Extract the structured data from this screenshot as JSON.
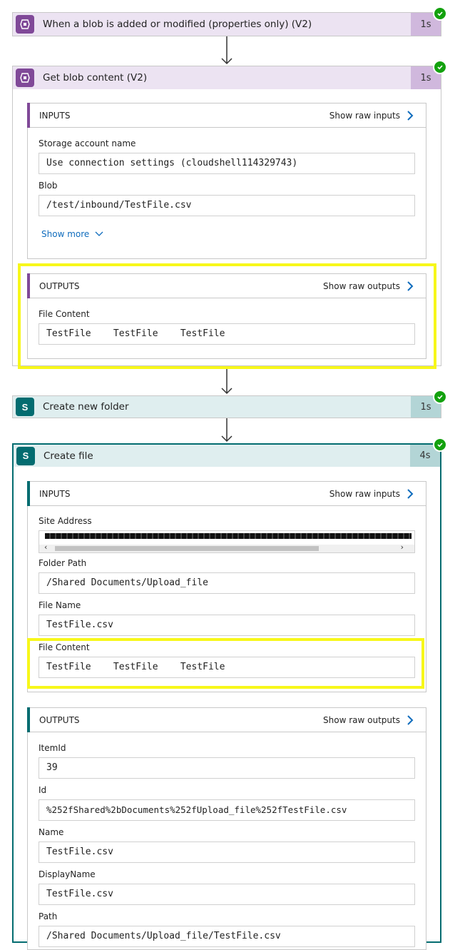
{
  "step1": {
    "title": "When a blob is added or modified (properties only) (V2)",
    "duration": "1s"
  },
  "step2": {
    "title": "Get blob content (V2)",
    "duration": "1s",
    "inputs": {
      "label": "INPUTS",
      "raw_label": "Show raw inputs",
      "storage_label": "Storage account name",
      "storage_value": "Use connection settings (cloudshell114329743)",
      "blob_label": "Blob",
      "blob_value": "/test/inbound/TestFile.csv",
      "show_more": "Show more"
    },
    "outputs": {
      "label": "OUTPUTS",
      "raw_label": "Show raw outputs",
      "file_content_label": "File Content",
      "file_content_value": "TestFile    TestFile    TestFile"
    }
  },
  "step3": {
    "title": "Create new folder",
    "duration": "1s"
  },
  "step4": {
    "title": "Create file",
    "duration": "4s",
    "inputs": {
      "label": "INPUTS",
      "raw_label": "Show raw inputs",
      "site_label": "Site Address",
      "folder_label": "Folder Path",
      "folder_value": "/Shared Documents/Upload_file",
      "name_label": "File Name",
      "name_value": "TestFile.csv",
      "content_label": "File Content",
      "content_value": "TestFile    TestFile    TestFile"
    },
    "outputs": {
      "label": "OUTPUTS",
      "raw_label": "Show raw outputs",
      "itemid_label": "ItemId",
      "itemid_value": "39",
      "id_label": "Id",
      "id_value": "%252fShared%2bDocuments%252fUpload_file%252fTestFile.csv",
      "name_label": "Name",
      "name_value": "TestFile.csv",
      "display_label": "DisplayName",
      "display_value": "TestFile.csv",
      "path_label": "Path",
      "path_value": "/Shared Documents/Upload_file/TestFile.csv"
    }
  },
  "colors": {
    "blob_accent": "#804998",
    "sharepoint_accent": "#036c70",
    "success": "#13a10e",
    "highlight": "#f7f71a",
    "link": "#0f6cbd"
  }
}
